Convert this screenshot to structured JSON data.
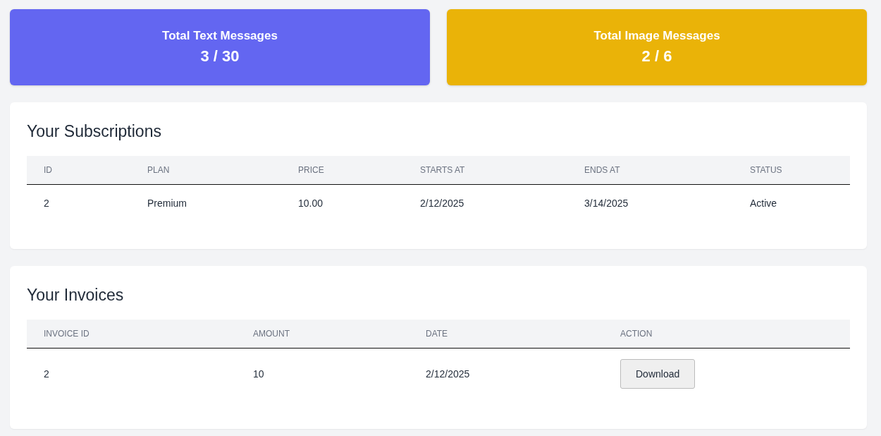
{
  "stats": [
    {
      "kind": "text",
      "label": "Total Text Messages",
      "value": "3 / 30"
    },
    {
      "kind": "image",
      "label": "Total Image Messages",
      "value": "2 / 6"
    }
  ],
  "subscriptions": {
    "title": "Your Subscriptions",
    "columns": [
      "ID",
      "PLAN",
      "PRICE",
      "STARTS AT",
      "ENDS AT",
      "STATUS"
    ],
    "rows": [
      [
        "2",
        "Premium",
        "10.00",
        "2/12/2025",
        "3/14/2025",
        "Active"
      ]
    ]
  },
  "invoices": {
    "title": "Your Invoices",
    "columns": [
      "INVOICE ID",
      "AMOUNT",
      "DATE",
      "ACTION"
    ],
    "rows": [
      {
        "cells": [
          "2",
          "10",
          "2/12/2025"
        ],
        "action": "Download"
      }
    ]
  }
}
